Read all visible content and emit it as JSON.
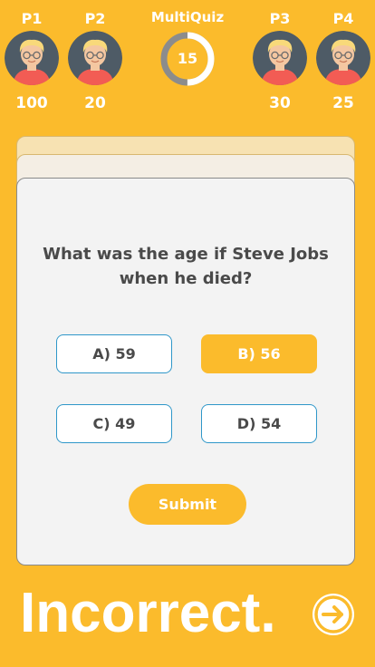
{
  "app": {
    "title": "MultiQuiz",
    "timer": "15",
    "timer_progress": 0.5
  },
  "players": [
    {
      "label": "P1",
      "score": "100"
    },
    {
      "label": "P2",
      "score": "20"
    },
    {
      "label": "P3",
      "score": "30"
    },
    {
      "label": "P4",
      "score": "25"
    }
  ],
  "question": {
    "text": "What was the age if Steve Jobs when he died?"
  },
  "answers": [
    {
      "label": "A) 59",
      "selected": false
    },
    {
      "label": "B) 56",
      "selected": true
    },
    {
      "label": "C) 49",
      "selected": false
    },
    {
      "label": "D) 54",
      "selected": false
    }
  ],
  "submit_label": "Submit",
  "result_text": "Incorrect.",
  "icons": {
    "avatar": "player-avatar-icon",
    "next": "arrow-right-circle-icon"
  },
  "colors": {
    "background": "#FBBB2C",
    "card": "#F3F3F3",
    "answer_border": "#2F97C9",
    "text": "#4A4A4A",
    "avatar_bg": "#4E5B66",
    "shirt": "#F25C54"
  }
}
